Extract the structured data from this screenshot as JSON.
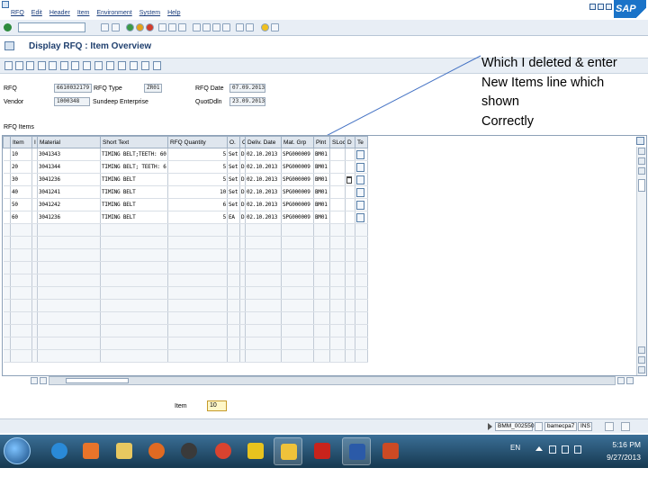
{
  "menu": {
    "items": [
      "RFQ",
      "Edit",
      "Header",
      "Item",
      "Environment",
      "System",
      "Help"
    ],
    "logo": "SAP"
  },
  "title": "Display RFQ : Item Overview",
  "header": {
    "rfq_label": "RFQ",
    "rfq_value": "6610032179",
    "rfq_type_label": "RFQ Type",
    "rfq_type_value": "ZR01",
    "rfq_date_label": "RFQ Date",
    "rfq_date_value": "07.09.2013",
    "vendor_label": "Vendor",
    "vendor_value": "1000348",
    "vendor_name": "Sundeep Enterprise",
    "quotddln_label": "QuotDdln",
    "quotddln_value": "23.09.2013"
  },
  "annotation": {
    "lines": [
      "Which I deleted & enter",
      "New Items line which",
      "shown",
      "Correctly"
    ]
  },
  "items_section_label": "RFQ Items",
  "table": {
    "columns": [
      "Item",
      "I",
      "Material",
      "Short Text",
      "RFQ Quantity",
      "O.",
      "C",
      "Deliv. Date",
      "Mat. Grp",
      "Plnt",
      "SLoc",
      "D",
      "Te"
    ],
    "rows": [
      {
        "item": "10",
        "material": "3041343",
        "short_text": "TIMING BELT;TEETH: 60...",
        "qty": "5",
        "oun": "Set",
        "c": "D",
        "date": "02.10.2013",
        "matgrp": "SPG000009",
        "plnt": "BM01",
        "sloc": "",
        "trash": false
      },
      {
        "item": "20",
        "material": "3041344",
        "short_text": "TIMING BELT; TEETH: 6...",
        "qty": "5",
        "oun": "Set",
        "c": "D",
        "date": "02.10.2013",
        "matgrp": "SPG000009",
        "plnt": "BM01",
        "sloc": "",
        "trash": false
      },
      {
        "item": "30",
        "material": "3041236",
        "short_text": "TIMING BELT",
        "qty": "5",
        "oun": "Set",
        "c": "D",
        "date": "02.10.2013",
        "matgrp": "SPG000009",
        "plnt": "BM01",
        "sloc": "",
        "trash": true
      },
      {
        "item": "40",
        "material": "3041241",
        "short_text": "TIMING BELT",
        "qty": "10",
        "oun": "Set",
        "c": "D",
        "date": "02.10.2013",
        "matgrp": "SPG000009",
        "plnt": "BM01",
        "sloc": "",
        "trash": false
      },
      {
        "item": "50",
        "material": "3041242",
        "short_text": "TIMING BELT",
        "qty": "6",
        "oun": "Set",
        "c": "D",
        "date": "02.10.2013",
        "matgrp": "SPG000009",
        "plnt": "BM01",
        "sloc": "",
        "trash": false
      },
      {
        "item": "60",
        "material": "3041236",
        "short_text": "TIMING BELT",
        "qty": "5",
        "oun": "EA",
        "c": "D",
        "date": "02.10.2013",
        "matgrp": "SPG000009",
        "plnt": "BM01",
        "sloc": "",
        "trash": false
      }
    ],
    "empty_rows": 11
  },
  "item_entry": {
    "label": "Item",
    "value": "10"
  },
  "status": {
    "session": "BMM_002550",
    "server": "bamecpa7",
    "mode": "INS"
  },
  "taskbar": {
    "language": "EN",
    "time": "5:16 PM",
    "date": "9/27/2013"
  }
}
